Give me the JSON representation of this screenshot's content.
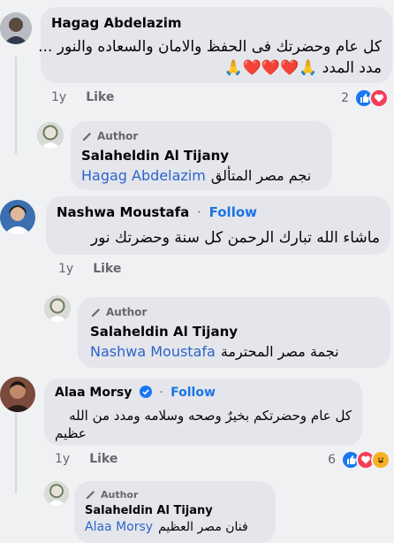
{
  "comments": [
    {
      "name": "Hagag Abdelazim",
      "line1": "كل عام وحضرتك فى الحفظ والامان والسعاده والنور ...",
      "line2": "مدد المدد 🙏❤️❤️❤️🙏",
      "time": "1y",
      "like_label": "Like",
      "reaction_count": "2"
    },
    {
      "badge": "Author",
      "name": "Salaheldin Al Tijany",
      "mention": "Hagag Abdelazim",
      "text": "نجم مصر المتألق"
    },
    {
      "name": "Nashwa Moustafa",
      "follow_label": "Follow",
      "text": "ماشاء الله تبارك الرحمن كل سنة وحضرتك نور",
      "time": "1y",
      "like_label": "Like"
    },
    {
      "badge": "Author",
      "name": "Salaheldin Al Tijany",
      "mention": "Nashwa Moustafa",
      "text": "نجمة مصر المحترمة"
    },
    {
      "name": "Alaa Morsy",
      "follow_label": "Follow",
      "line1": "كل عام وحضرتكم بخيرٌ وصحه وسلامه ومدد من الله",
      "line2": "عظيم",
      "time": "1y",
      "like_label": "Like",
      "reaction_count": "6"
    },
    {
      "badge": "Author",
      "name": "Salaheldin Al Tijany",
      "mention": "Alaa Morsy",
      "text": "فنان مصر العظيم"
    }
  ],
  "colors": {
    "bubble": "#e4e6eb",
    "link": "#2d64c9",
    "follow": "#1b74e4",
    "like": "#1877f2",
    "love": "#f33e58",
    "haha": "#f7b125"
  }
}
